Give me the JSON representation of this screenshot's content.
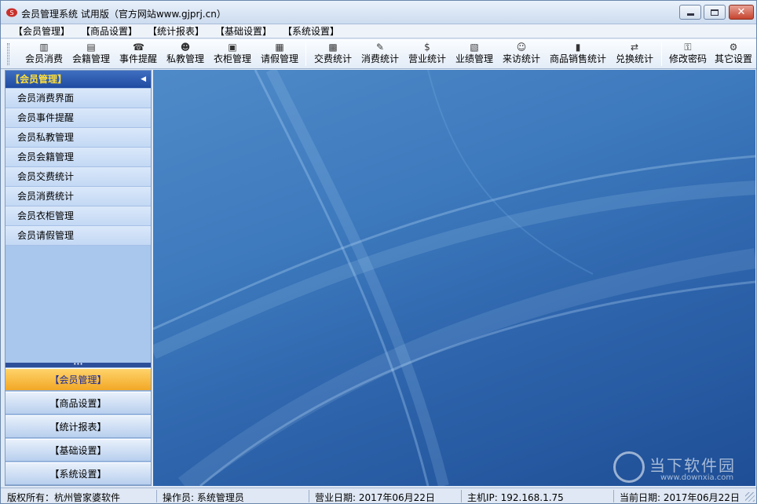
{
  "window": {
    "title": "会员管理系统 试用版（官方网站www.gjprj.cn）"
  },
  "menu": {
    "items": [
      "【会员管理】",
      "【商品设置】",
      "【统计报表】",
      "【基础设置】",
      "【系统设置】"
    ]
  },
  "toolbar": {
    "group1": [
      {
        "label": "会员消费",
        "icon": "barcode-icon"
      },
      {
        "label": "会籍管理",
        "icon": "card-icon"
      },
      {
        "label": "事件提醒",
        "icon": "phone-icon"
      },
      {
        "label": "私教管理",
        "icon": "coach-icon"
      },
      {
        "label": "衣柜管理",
        "icon": "locker-icon"
      },
      {
        "label": "请假管理",
        "icon": "calendar-icon"
      }
    ],
    "group2": [
      {
        "label": "交费统计",
        "icon": "calculator-icon"
      },
      {
        "label": "消费统计",
        "icon": "pen-icon"
      },
      {
        "label": "营业统计",
        "icon": "money-bag-icon"
      },
      {
        "label": "业绩管理",
        "icon": "document-icon"
      },
      {
        "label": "来访统计",
        "icon": "visitor-icon"
      },
      {
        "label": "商品销售统计",
        "icon": "bar-chart-icon"
      },
      {
        "label": "兑换统计",
        "icon": "exchange-icon"
      }
    ],
    "group3": [
      {
        "label": "修改密码",
        "icon": "key-icon"
      },
      {
        "label": "其它设置",
        "icon": "settings-doc-icon"
      }
    ]
  },
  "nav": {
    "header": "【会员管理】",
    "items": [
      "会员消费界面",
      "会员事件提醒",
      "会员私教管理",
      "会员会籍管理",
      "会员交费统计",
      "会员消费统计",
      "会员衣柜管理",
      "会员请假管理"
    ],
    "groups": [
      "【会员管理】",
      "【商品设置】",
      "【统计报表】",
      "【基础设置】",
      "【系统设置】"
    ],
    "active_group": 0
  },
  "watermark": {
    "title": "当下软件园",
    "url": "www.downxia.com"
  },
  "status": {
    "copyright": "版权所有：杭州管家婆软件",
    "operator": "操作员: 系统管理员",
    "business_date": "营业日期: 2017年06月22日",
    "host_ip": "主机IP: 192.168.1.75",
    "current_date": "当前日期: 2017年06月22日"
  },
  "colors": {
    "nav_header": "#1f4aa1",
    "active_group": "#f2a826",
    "content_bg": "#2f66ad"
  }
}
